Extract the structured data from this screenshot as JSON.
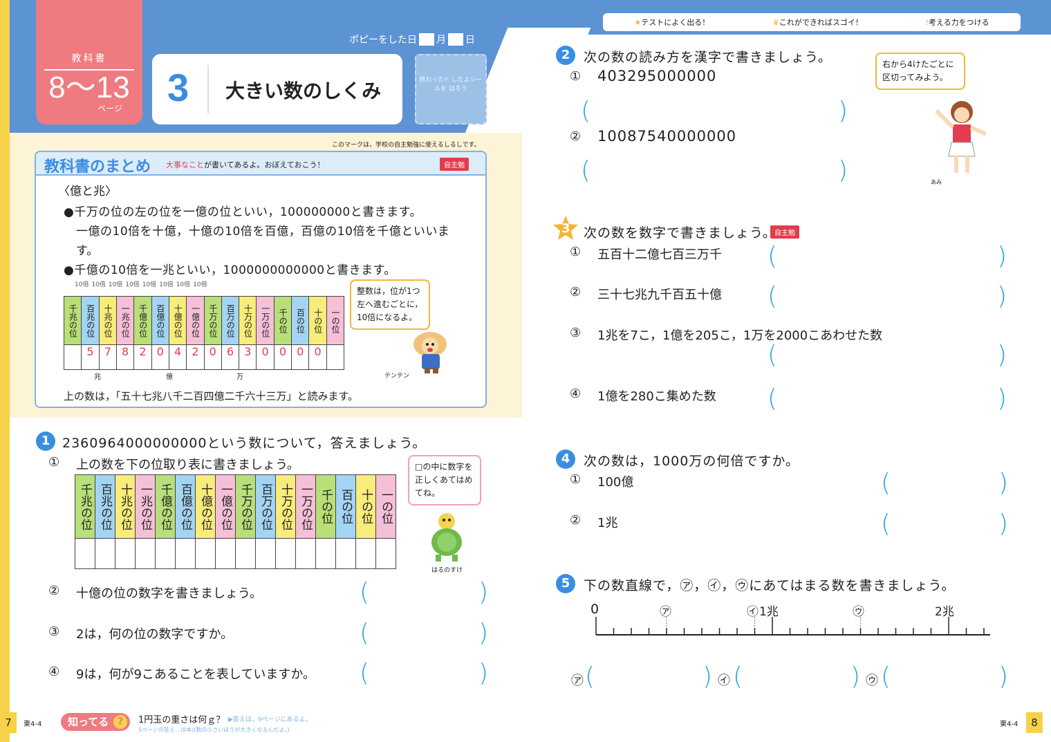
{
  "header": {
    "textbook_label": "教科書",
    "pages_range": "8～13",
    "pages_unit": "ページ",
    "unit_number": "3",
    "unit_title": "大きい数のしくみ",
    "study_date_label": "ポピーをした日",
    "month_label": "月",
    "day_label": "日",
    "sticker_text": "終わった!! したよシールを はろう"
  },
  "legend": {
    "item1": "テストによく出る！",
    "item2": "これができればスゴイ！",
    "item3": "考える力をつける"
  },
  "summary": {
    "mark_note": "このマークは，学校の自主勉強に使えるしるしです。",
    "title": "教科書のまとめ",
    "subtitle_red": "大事なこと",
    "subtitle_rest": "が書いてあるよ。おぼえておこう！",
    "tag": "自主勉",
    "heading": "〈億と兆〉",
    "line1": "●千万の位の左の位を一億の位といい，100000000と書きます。",
    "line2": "一億の10倍を十億，十億の10倍を百億，百億の10倍を千億といいま",
    "line3": "す。",
    "line4": "●千億の10倍を一兆といい，1000000000000と書きます。",
    "ten_times": [
      "10倍",
      "10倍",
      "10倍",
      "10倍",
      "10倍",
      "10倍",
      "10倍",
      "10倍"
    ],
    "table_headers": [
      "千兆の位",
      "百兆の位",
      "十兆の位",
      "一兆の位",
      "千億の位",
      "百億の位",
      "十億の位",
      "一億の位",
      "千万の位",
      "百万の位",
      "十万の位",
      "一万の位",
      "千の位",
      "百の位",
      "十の位",
      "一の位"
    ],
    "table_digits": [
      "",
      "5",
      "7",
      "8",
      "2",
      "0",
      "4",
      "2",
      "0",
      "6",
      "3",
      "0",
      "0",
      "0",
      "0",
      ""
    ],
    "group_cho": "兆",
    "group_oku": "億",
    "group_man": "万",
    "bubble": "整数は，位が1つ左へ進むごとに，10倍になるよ。",
    "character": "テンテン",
    "reading": "上の数は，「五十七兆八千二百四億二千六十三万」と読みます。"
  },
  "q1": {
    "number": "1",
    "text": "2360964000000000という数について，答えましょう。",
    "sub1": "上の数を下の位取り表に書きましょう。",
    "table_headers": [
      "千兆の位",
      "百兆の位",
      "十兆の位",
      "一兆の位",
      "千億の位",
      "百億の位",
      "十億の位",
      "一億の位",
      "千万の位",
      "百万の位",
      "十万の位",
      "一万の位",
      "千の位",
      "百の位",
      "十の位",
      "一の位"
    ],
    "bubble": "□の中に数字を正しくあてはめてね。",
    "character": "はるのすけ",
    "sub2": "十億の位の数字を書きましょう。",
    "sub3": "2は，何の位の数字ですか。",
    "sub4": "9は，何が9こあることを表していますか。"
  },
  "q2": {
    "number": "2",
    "text": "次の数の読み方を漢字で書きましょう。",
    "sub1": "403295000000",
    "sub2": "10087540000000",
    "bubble": "右から4けたごとに区切ってみよう。",
    "character": "あみ"
  },
  "q3": {
    "number": "3",
    "text": "次の数を数字で書きましょう。",
    "tag": "自主勉",
    "sub1": "五百十二億七百三万千",
    "sub2": "三十七兆九千百五十億",
    "sub3": "1兆を7こ，1億を205こ，1万を2000こあわせた数",
    "sub4": "1億を280こ集めた数"
  },
  "q4": {
    "number": "4",
    "text": "次の数は，1000万の何倍ですか。",
    "sub1": "100億",
    "sub2": "1兆"
  },
  "q5": {
    "number": "5",
    "text": "下の数直線で，㋐，㋑，㋒にあてはまる数を書きましょう。",
    "zero": "0",
    "a_label": "㋐",
    "b_label": "㋑",
    "one_cho": "1兆",
    "c_label": "㋒",
    "two_cho": "2兆"
  },
  "footer": {
    "page_left": "7",
    "code_left": "東4-4",
    "shitteru": "知ってる",
    "trivia": "1円玉の重さは何ｇ？",
    "trivia_answer": "▶答えは，9ページにあるよ。",
    "prev_answer": "5ページの答え…(8本)(数の小さいほうが大きくなるんだよ。)",
    "code_right": "東4-4",
    "page_right": "8"
  },
  "marks": {
    "circle1": "①",
    "circle2": "②",
    "circle3": "③",
    "circle4": "④",
    "paren_open": "(",
    "paren_close": ")"
  }
}
